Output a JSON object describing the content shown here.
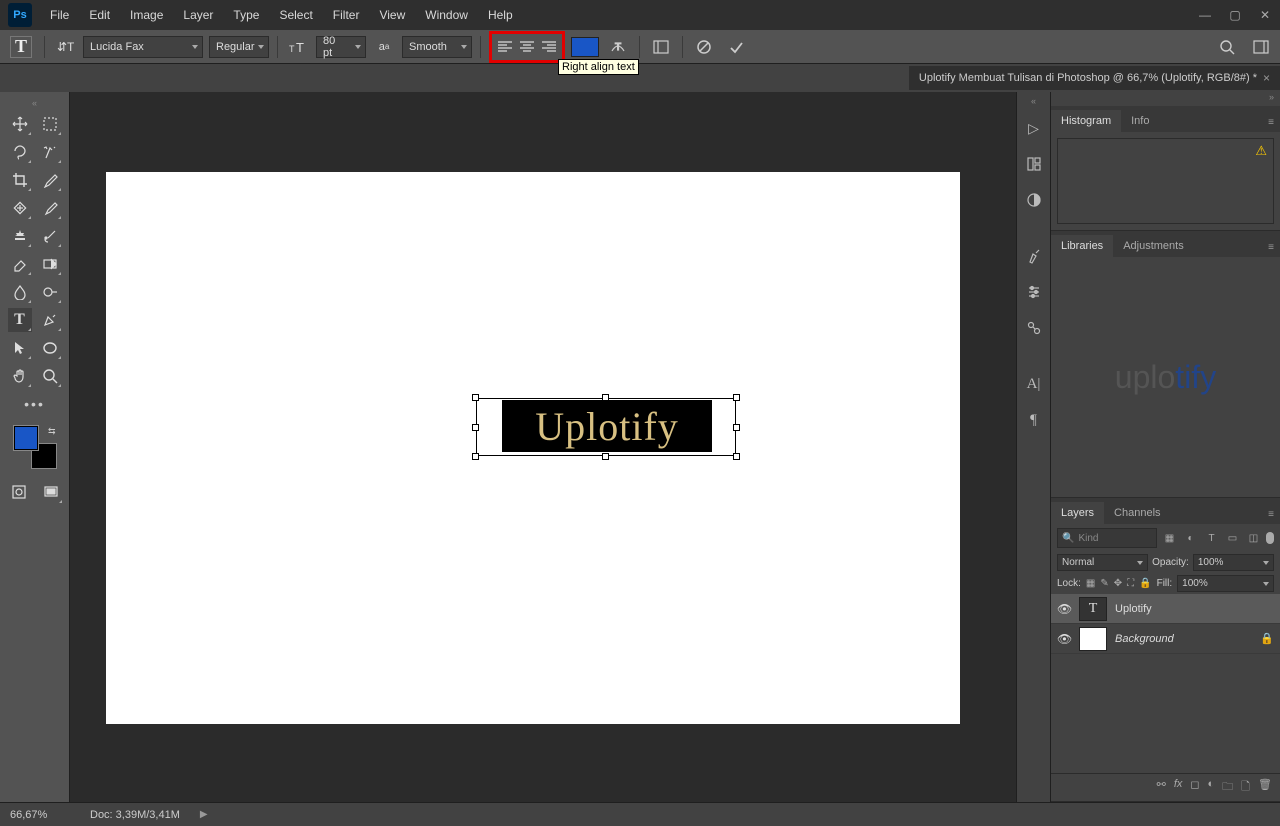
{
  "app": {
    "icon_text": "Ps"
  },
  "menu": {
    "items": [
      "File",
      "Edit",
      "Image",
      "Layer",
      "Type",
      "Select",
      "Filter",
      "View",
      "Window",
      "Help"
    ]
  },
  "options": {
    "font_family": "Lucida Fax",
    "font_style": "Regular",
    "font_size": "80 pt",
    "anti_alias": "Smooth",
    "tooltip": "Right align text"
  },
  "document": {
    "tab_title": "Uplotify Membuat Tulisan di Photoshop @ 66,7% (Uplotify, RGB/8#) *"
  },
  "canvas_text": "Uplotify",
  "panels": {
    "histogram": {
      "tab1": "Histogram",
      "tab2": "Info"
    },
    "libraries": {
      "tab1": "Libraries",
      "tab2": "Adjustments",
      "logo_a": "uplo",
      "logo_b": "tify"
    },
    "layers": {
      "tab1": "Layers",
      "tab2": "Channels",
      "search_placeholder": "Kind",
      "blend_mode": "Normal",
      "opacity_label": "Opacity:",
      "opacity_value": "100%",
      "lock_label": "Lock:",
      "fill_label": "Fill:",
      "fill_value": "100%",
      "layer1_name": "Uplotify",
      "layer2_name": "Background"
    }
  },
  "status": {
    "zoom": "66,67%",
    "doc_size": "Doc: 3,39M/3,41M"
  }
}
